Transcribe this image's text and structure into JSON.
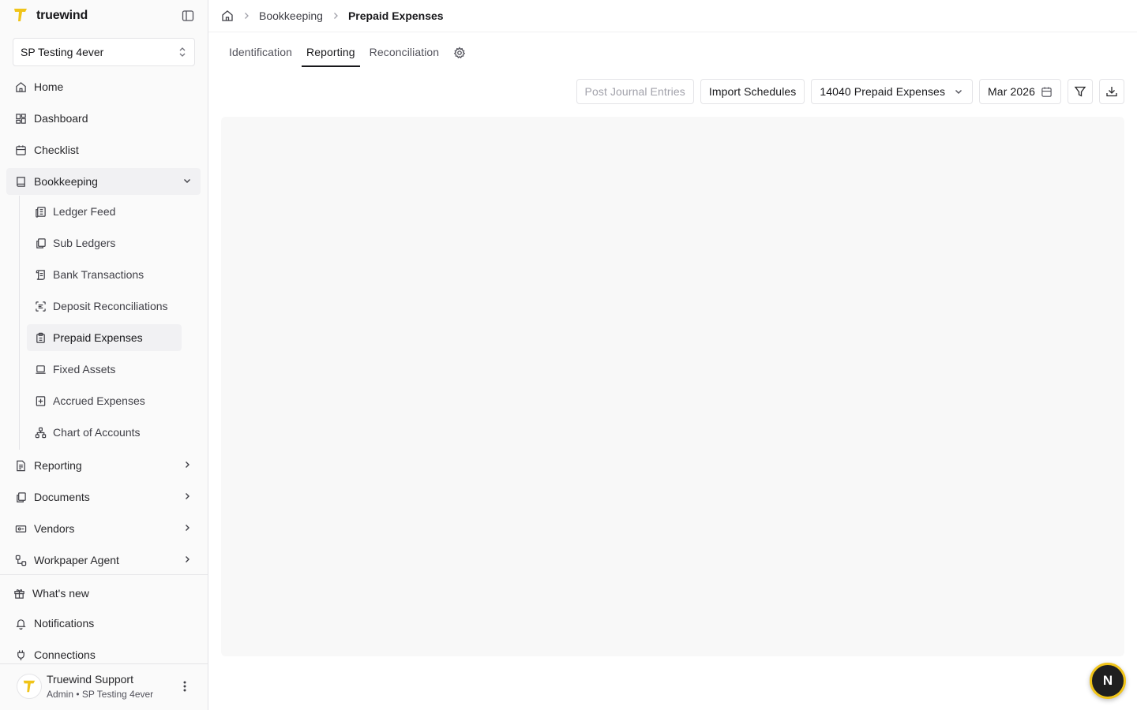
{
  "brand": {
    "name": "truewind"
  },
  "org_selector": {
    "value": "SP Testing 4ever"
  },
  "sidebar": {
    "items": [
      {
        "label": "Home",
        "icon": "home-icon"
      },
      {
        "label": "Dashboard",
        "icon": "dashboard-icon"
      },
      {
        "label": "Checklist",
        "icon": "calendar-icon"
      },
      {
        "label": "Bookkeeping",
        "icon": "book-icon",
        "expanded": true
      },
      {
        "label": "Reporting",
        "icon": "file-text-icon"
      },
      {
        "label": "Documents",
        "icon": "documents-icon"
      },
      {
        "label": "Vendors",
        "icon": "vendor-card-icon"
      },
      {
        "label": "Workpaper Agent",
        "icon": "workflow-icon"
      }
    ],
    "bookkeeping_children": [
      {
        "label": "Ledger Feed",
        "icon": "ledger-icon"
      },
      {
        "label": "Sub Ledgers",
        "icon": "copy-icon"
      },
      {
        "label": "Bank Transactions",
        "icon": "scroll-icon"
      },
      {
        "label": "Deposit Reconciliations",
        "icon": "scan-text-icon"
      },
      {
        "label": "Prepaid Expenses",
        "icon": "clipboard-icon",
        "selected": true
      },
      {
        "label": "Fixed Assets",
        "icon": "laptop-icon"
      },
      {
        "label": "Accrued Expenses",
        "icon": "plus-square-icon"
      },
      {
        "label": "Chart of Accounts",
        "icon": "hierarchy-icon"
      }
    ],
    "footer_items": [
      {
        "label": "What's new",
        "icon": "gift-icon"
      },
      {
        "label": "Notifications",
        "icon": "bell-icon"
      },
      {
        "label": "Connections",
        "icon": "plug-icon"
      }
    ]
  },
  "user": {
    "name": "Truewind Support",
    "subtitle": "Admin • SP Testing 4ever"
  },
  "breadcrumb": {
    "section": "Bookkeeping",
    "current": "Prepaid Expenses"
  },
  "tabs": [
    {
      "label": "Identification",
      "active": false
    },
    {
      "label": "Reporting",
      "active": true
    },
    {
      "label": "Reconciliation",
      "active": false
    }
  ],
  "toolbar": {
    "post_journal_entries": "Post Journal Entries",
    "import_schedules": "Import Schedules",
    "account_select": "14040 Prepaid Expenses",
    "period_select": "Mar 2026"
  },
  "assistant": {
    "label": "N"
  },
  "colors": {
    "brand_yellow": "#F0C419",
    "sidebar_bg": "#FAFAFA",
    "panel_bg": "#F8F8F8",
    "text_primary": "#18181B"
  }
}
